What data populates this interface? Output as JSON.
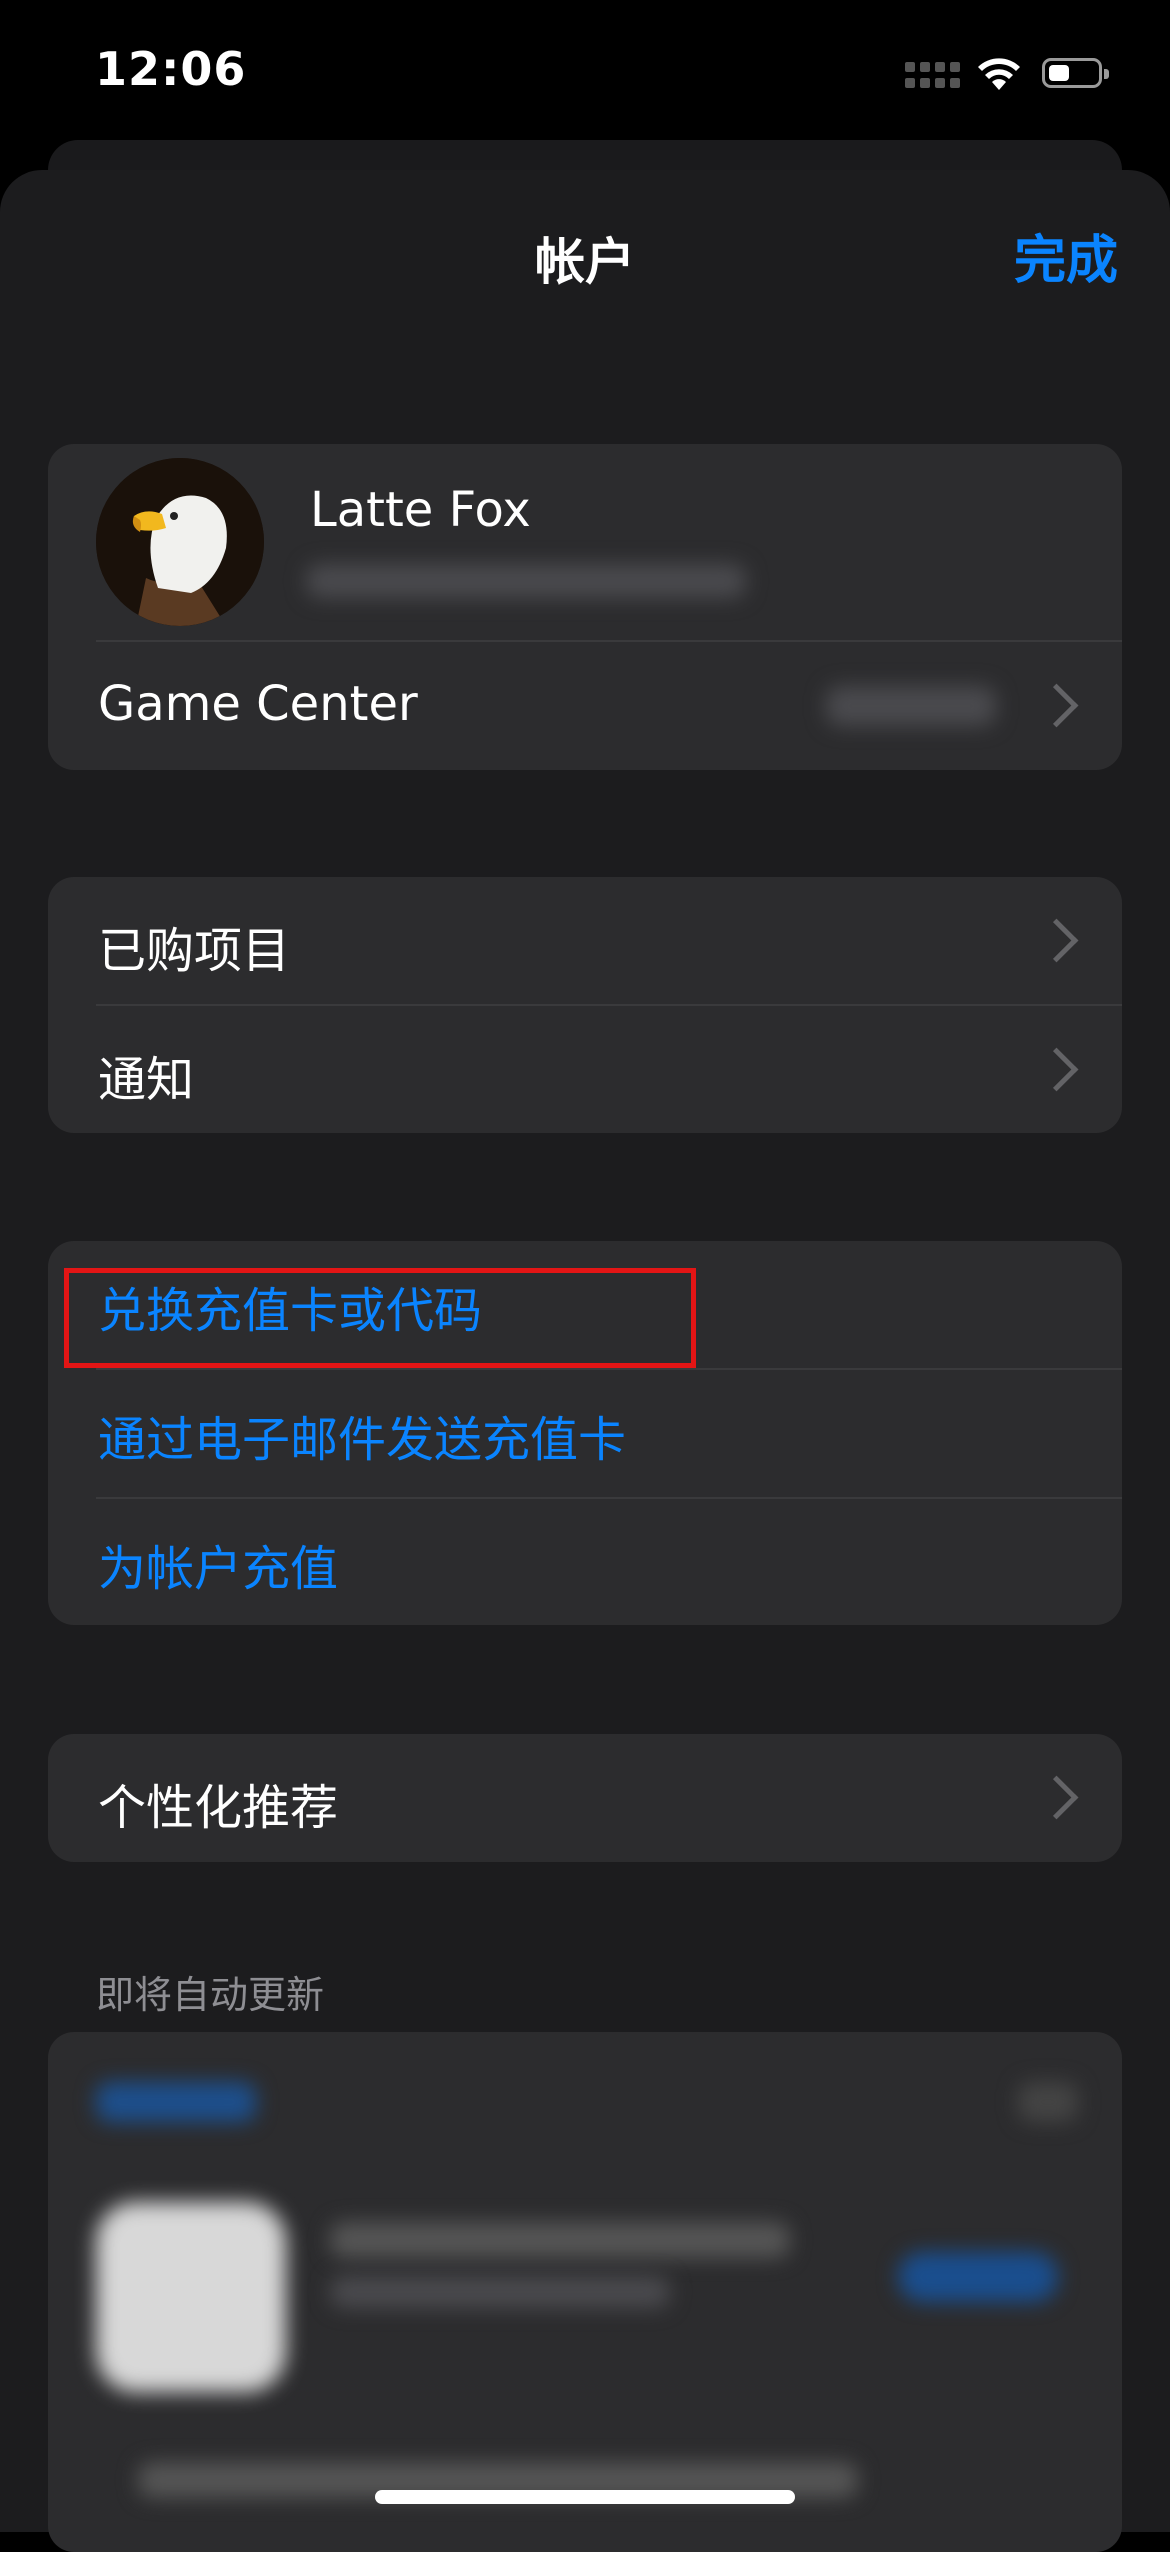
{
  "status_bar": {
    "time": "12:06"
  },
  "nav": {
    "title": "帐户",
    "done_label": "完成"
  },
  "profile": {
    "name": "Latte Fox",
    "game_center_label": "Game Center"
  },
  "list_one": {
    "purchased": "已购项目",
    "notifications": "通知"
  },
  "list_two": {
    "redeem": "兑换充值卡或代码",
    "send_gift_card": "通过电子邮件发送充值卡",
    "add_funds": "为帐户充值"
  },
  "list_three": {
    "personalized": "个性化推荐"
  },
  "upcoming": {
    "header": "即将自动更新"
  },
  "colors": {
    "accent": "#0a84ff",
    "highlight": "#e31515",
    "background": "#1c1c1e",
    "group": "#2c2c2e"
  },
  "icons": [
    "wifi-icon",
    "battery-icon",
    "cellular-signal-icon",
    "chevron-right-icon"
  ]
}
